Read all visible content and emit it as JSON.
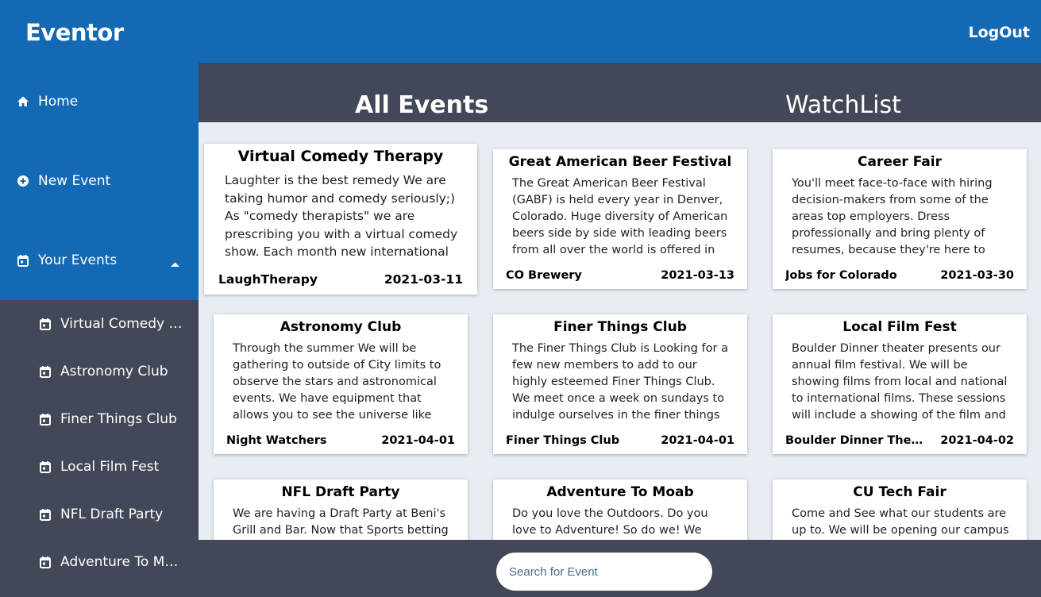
{
  "app": {
    "brand": "Eventor",
    "logout_label": "LogOut"
  },
  "sidebar": {
    "home_label": "Home",
    "new_event_label": "New Event",
    "your_events_label": "Your Events",
    "your_events_items": [
      "Virtual Comedy Therapy",
      "Astronomy Club",
      "Finer Things Club",
      "Local Film Fest",
      "NFL Draft Party",
      "Adventure To Moab"
    ]
  },
  "tabs": {
    "all_events": "All Events",
    "watchlist": "WatchList"
  },
  "events": [
    {
      "title": "Virtual Comedy Therapy",
      "description": "Laughter is the best remedy We are taking humor and comedy seriously;) As \"comedy therapists\" we are prescribing you with a virtual comedy show. Each month new international",
      "host": "LaughTherapy",
      "date": "2021-03-11"
    },
    {
      "title": "Great American Beer Festival",
      "description": "The Great American Beer Festival (GABF) is held every year in Denver, Colorado. Huge diversity of American beers side by side with leading beers from all over the world is offered in",
      "host": "CO Brewery",
      "date": "2021-03-13"
    },
    {
      "title": "Career Fair",
      "description": "You'll meet face-to-face with hiring decision-makers from some of the areas top employers. Dress professionally and bring plenty of resumes, because they're here to hire.",
      "host": "Jobs for Colorado",
      "date": "2021-03-30"
    },
    {
      "title": "Astronomy Club",
      "description": "Through the summer We will be gathering to outside of City limits to observe the stars and astronomical events. We have equipment that allows you to see the universe like you",
      "host": "Night Watchers",
      "date": "2021-04-01"
    },
    {
      "title": "Finer Things Club",
      "description": "The Finer Things Club is Looking for a few new members to add to our highly esteemed Finer Things Club. We meet once a week on sundays to indulge ourselves in the finer things in",
      "host": "Finer Things Club",
      "date": "2021-04-01"
    },
    {
      "title": "Local Film Fest",
      "description": "Boulder Dinner theater presents our annual film festival. We will be showing films from local and national to international films. These sessions will include a showing of the film and",
      "host": "Boulder Dinner Theater",
      "date": "2021-04-02"
    },
    {
      "title": "NFL Draft Party",
      "description": "We are having a Draft Party at Beni's Grill and Bar. Now that Sports betting",
      "host": "",
      "date": ""
    },
    {
      "title": "Adventure To Moab",
      "description": "Do you love the Outdoors. Do you love to Adventure! So do we! We have",
      "host": "",
      "date": ""
    },
    {
      "title": "CU Tech Fair",
      "description": "Come and See what our students are up to. We will be opening our campus",
      "host": "",
      "date": ""
    }
  ],
  "search": {
    "placeholder": "Search for Event"
  }
}
